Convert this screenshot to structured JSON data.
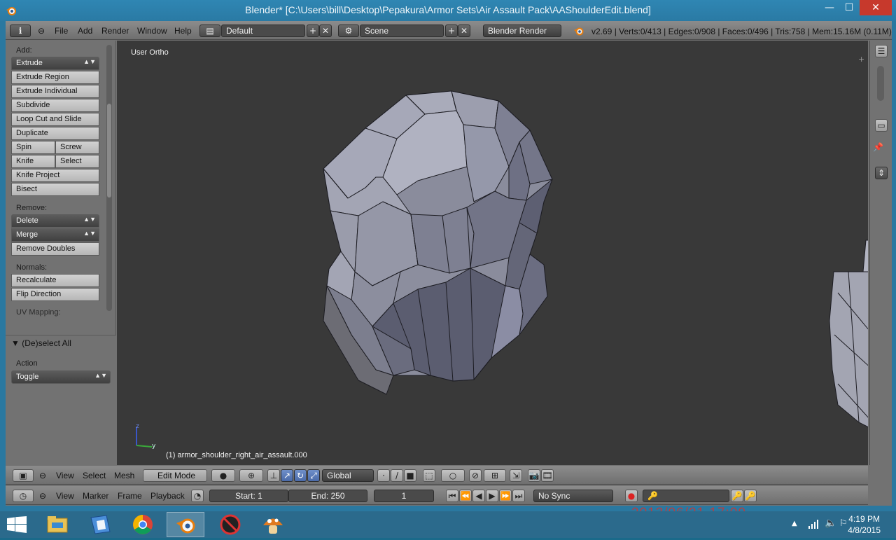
{
  "window": {
    "title": "Blender* [C:\\Users\\bill\\Desktop\\Pepakura\\Armor Sets\\Air Assault Pack\\AAShoulderEdit.blend]",
    "minimize": "—",
    "maximize": "☐",
    "close": "✕"
  },
  "top_header": {
    "menus": [
      "File",
      "Add",
      "Render",
      "Window",
      "Help"
    ],
    "layout": "Default",
    "scene": "Scene",
    "engine": "Blender Render",
    "stats": "v2.69 | Verts:0/413 | Edges:0/908 | Faces:0/496 | Tris:758 | Mem:15.16M (0.11M) |"
  },
  "toolshelf": {
    "add_label": "Add:",
    "extrude": "Extrude",
    "extrude_region": "Extrude Region",
    "extrude_individual": "Extrude Individual",
    "subdivide": "Subdivide",
    "loop_cut": "Loop Cut and Slide",
    "duplicate": "Duplicate",
    "spin": "Spin",
    "screw": "Screw",
    "knife": "Knife",
    "select": "Select",
    "knife_project": "Knife Project",
    "bisect": "Bisect",
    "remove_label": "Remove:",
    "delete": "Delete",
    "merge": "Merge",
    "remove_doubles": "Remove Doubles",
    "normals_label": "Normals:",
    "recalculate": "Recalculate",
    "flip_direction": "Flip Direction",
    "uv_label": "UV Mapping:"
  },
  "operator_panel": {
    "title": "(De)select All",
    "action_label": "Action",
    "action_value": "Toggle"
  },
  "viewport": {
    "view_name": "User Ortho",
    "object_label": "(1) armor_shoulder_right_air_assault.000",
    "axis_z": "z",
    "axis_y": "y"
  },
  "view3d_header": {
    "menus": [
      "View",
      "Select",
      "Mesh"
    ],
    "mode": "Edit Mode",
    "orientation": "Global"
  },
  "timeline_header": {
    "menus": [
      "View",
      "Marker",
      "Frame",
      "Playback"
    ],
    "start": "Start: 1",
    "end": "End: 250",
    "current_frame": "1",
    "sync": "No Sync"
  },
  "taskbar": {
    "time": "4:19 PM",
    "date": "4/8/2015",
    "watermark": "2013/06/21 17:00"
  }
}
